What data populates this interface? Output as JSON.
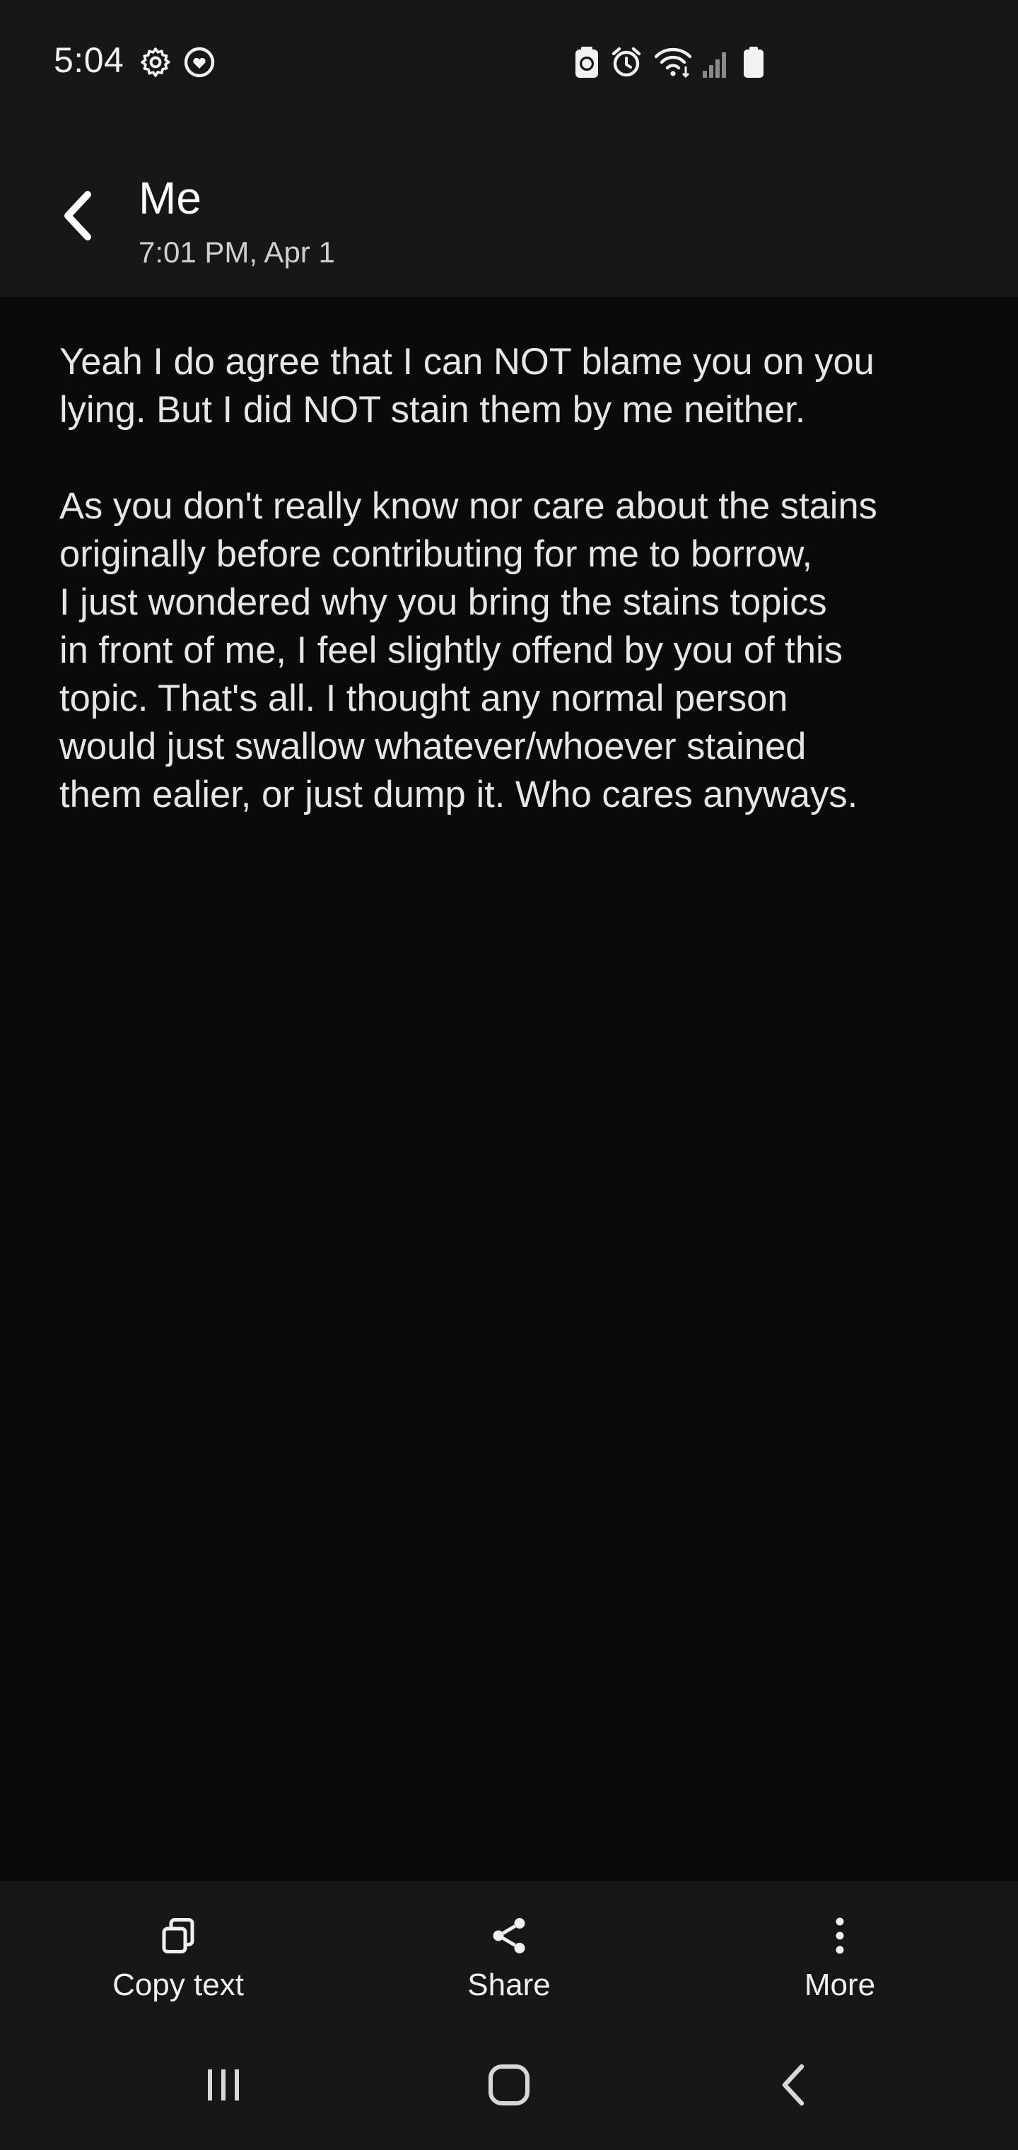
{
  "status_bar": {
    "time": "5:04",
    "left_icons": [
      "gear-icon",
      "heart-circle-icon"
    ],
    "right_icons": [
      "battery-saver-icon",
      "alarm-icon",
      "wifi-icon",
      "signal-icon",
      "battery-icon"
    ]
  },
  "header": {
    "title": "Me",
    "subtitle": "7:01 PM, Apr 1",
    "back_icon": "chevron-left-icon"
  },
  "message": {
    "paragraphs": [
      "Yeah I do agree that I can NOT blame you on you\nlying. But I did NOT stain them by me neither.",
      "As you don't really know nor care about the stains\noriginally before contributing for me to borrow,\nI just wondered why you bring the stains topics\nin front of me, I feel slightly offend by you of this\ntopic. That's all. I thought any normal person\nwould just swallow whatever/whoever stained\nthem ealier, or just dump it. Who cares anyways."
    ]
  },
  "actions": [
    {
      "label": "Copy text",
      "icon": "copy-icon"
    },
    {
      "label": "Share",
      "icon": "share-icon"
    },
    {
      "label": "More",
      "icon": "more-vertical-icon"
    }
  ],
  "nav": [
    "recent-apps-icon",
    "home-icon",
    "back-icon"
  ],
  "colors": {
    "background": "#0a0a0a",
    "bar": "#171717",
    "text": "#e6e6e6"
  }
}
